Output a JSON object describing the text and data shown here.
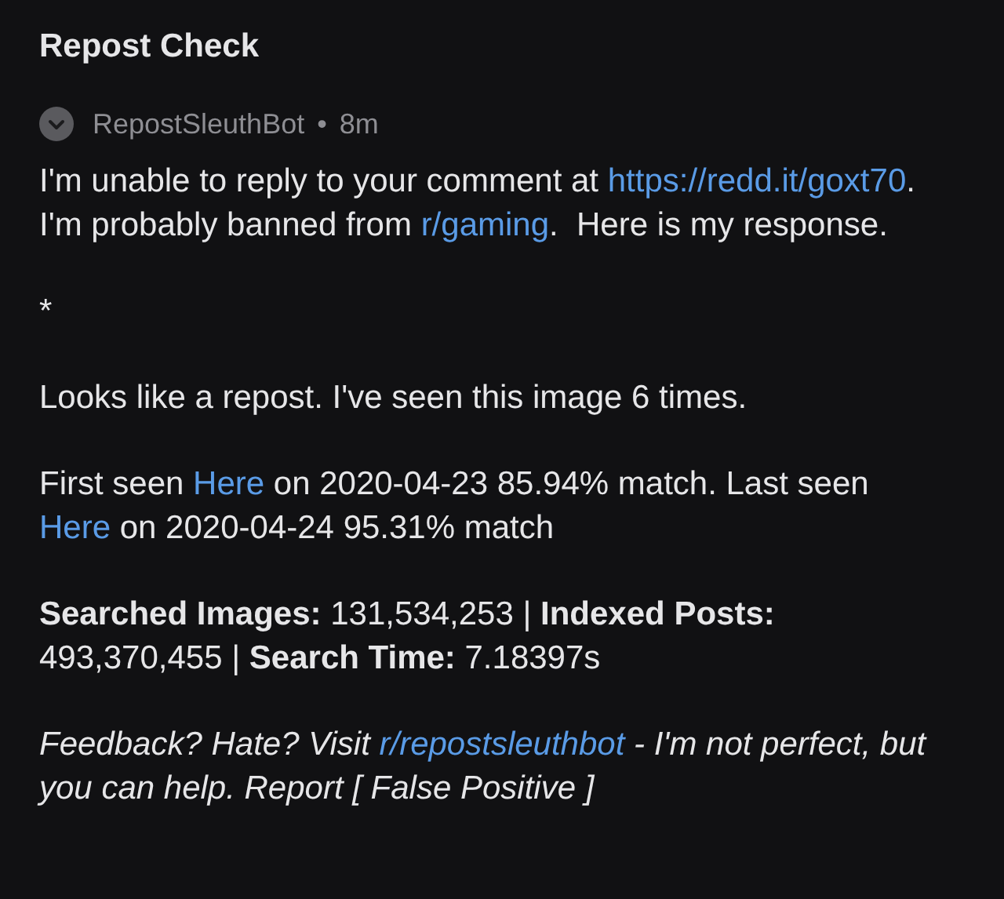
{
  "title": "Repost Check",
  "comment": {
    "author": "RepostSleuthBot",
    "separator": "•",
    "age": "8m"
  },
  "paragraphs": [
    {
      "italic": false,
      "segments": [
        {
          "kind": "text",
          "text": "I'm unable to reply to your comment at "
        },
        {
          "kind": "link",
          "text": "https://redd.it/goxt70"
        },
        {
          "kind": "text",
          "text": ".  I'm probably banned from "
        },
        {
          "kind": "link",
          "text": "r/gaming"
        },
        {
          "kind": "text",
          "text": ".  Here is my response."
        }
      ]
    },
    {
      "italic": false,
      "segments": [
        {
          "kind": "text",
          "text": "*"
        }
      ]
    },
    {
      "italic": false,
      "segments": [
        {
          "kind": "text",
          "text": "Looks like a repost. I've seen this image 6 times."
        }
      ]
    },
    {
      "italic": false,
      "segments": [
        {
          "kind": "text",
          "text": "First seen "
        },
        {
          "kind": "link",
          "text": "Here"
        },
        {
          "kind": "text",
          "text": " on 2020-04-23 85.94% match. Last seen "
        },
        {
          "kind": "link",
          "text": "Here"
        },
        {
          "kind": "text",
          "text": " on 2020-04-24 95.31% match"
        }
      ]
    },
    {
      "italic": false,
      "segments": [
        {
          "kind": "bold",
          "text": "Searched Images:"
        },
        {
          "kind": "text",
          "text": " 131,534,253 | "
        },
        {
          "kind": "bold",
          "text": "Indexed Posts:"
        },
        {
          "kind": "text",
          "text": " 493,370,455 | "
        },
        {
          "kind": "bold",
          "text": "Search Time:"
        },
        {
          "kind": "text",
          "text": " 7.18397s"
        }
      ]
    },
    {
      "italic": true,
      "segments": [
        {
          "kind": "text",
          "text": "Feedback? Hate? Visit "
        },
        {
          "kind": "link",
          "text": "r/repostsleuthbot"
        },
        {
          "kind": "text",
          "text": " - I'm not perfect, but you can help. Report [ False Positive ]"
        }
      ]
    }
  ]
}
